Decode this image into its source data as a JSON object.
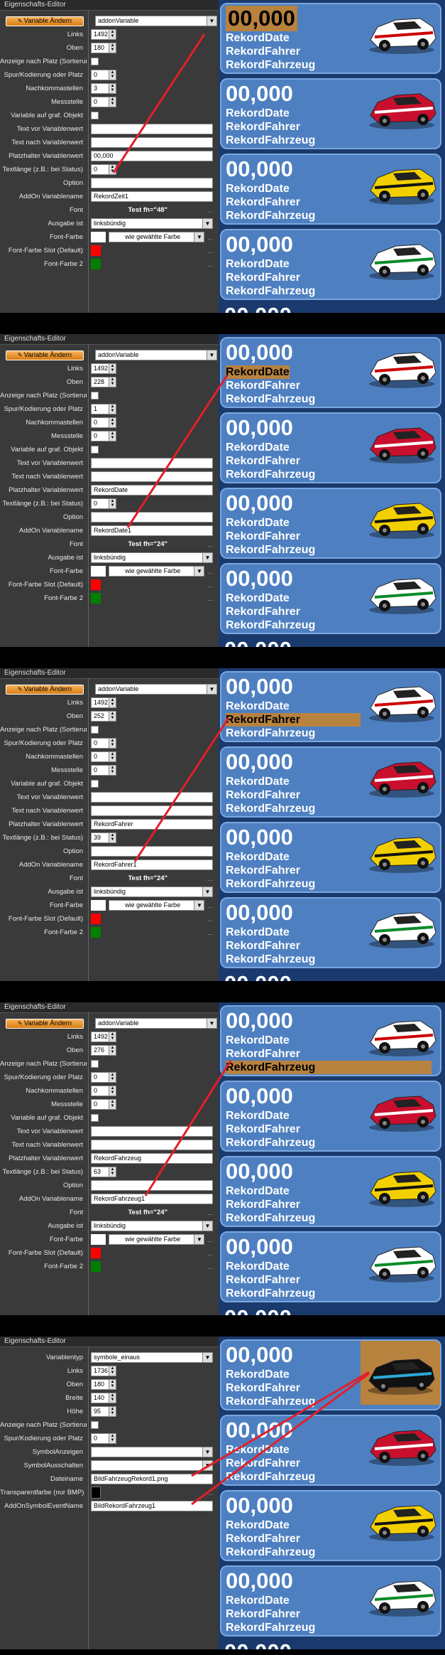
{
  "panels": [
    {
      "title": "Eigenschafts-Editor",
      "button_label": "Variable Ändern",
      "rows": [
        {
          "label": "",
          "type": "sel",
          "value": "addonVariable"
        },
        {
          "label": "Links",
          "type": "num",
          "value": "1492"
        },
        {
          "label": "Oben",
          "type": "num",
          "value": "180"
        },
        {
          "label": "Anzeige nach Platz (Sortierung)",
          "type": "chk"
        },
        {
          "label": "Spur/Kodierung oder Platz",
          "type": "num",
          "value": "0"
        },
        {
          "label": "Nachkommastellen",
          "type": "num",
          "value": "3"
        },
        {
          "label": "Messstelle",
          "type": "num",
          "value": "0"
        },
        {
          "label": "Variable auf graf. Objekt",
          "type": "chk"
        },
        {
          "label": "Text vor Variablenwert",
          "type": "txt",
          "value": ""
        },
        {
          "label": "Text nach Variablenwert",
          "type": "txt",
          "value": ""
        },
        {
          "label": "Platzhalter Variablenwert",
          "type": "txt",
          "value": "00,000"
        },
        {
          "label": "Textlänge (z.B.: bei Status)",
          "type": "num",
          "value": "0"
        },
        {
          "label": "Option",
          "type": "txt",
          "value": ""
        },
        {
          "label": "AddOn Variablename",
          "type": "txt",
          "value": "RekordZeit1"
        },
        {
          "label": "Font",
          "type": "font",
          "value": "Test fh=\"48\""
        },
        {
          "label": "Ausgabe ist",
          "type": "sel",
          "value": "linksbündig"
        },
        {
          "label": "Font-Farbe",
          "type": "color",
          "value": "wie gewählte Farbe",
          "color": "#ffffff"
        },
        {
          "label": "Font-Farbe Slot (Default)",
          "type": "swatch",
          "color": "#ff0000"
        },
        {
          "label": "Font-Farbe 2",
          "type": "swatch",
          "color": "#008000"
        }
      ],
      "highlight": 0,
      "line": [
        160,
        243,
        288,
        48
      ]
    },
    {
      "title": "Eigenschafts-Editor",
      "button_label": "Variable Ändern",
      "rows": [
        {
          "label": "",
          "type": "sel",
          "value": "addonVariable"
        },
        {
          "label": "Links",
          "type": "num",
          "value": "1492"
        },
        {
          "label": "Oben",
          "type": "num",
          "value": "228"
        },
        {
          "label": "Anzeige nach Platz (Sortierung)",
          "type": "chk"
        },
        {
          "label": "Spur/Kodierung oder Platz",
          "type": "num",
          "value": "1"
        },
        {
          "label": "Nachkommastellen",
          "type": "num",
          "value": "0"
        },
        {
          "label": "Messstelle",
          "type": "num",
          "value": "0"
        },
        {
          "label": "Variable auf graf. Objekt",
          "type": "chk"
        },
        {
          "label": "Text vor Variablenwert",
          "type": "txt",
          "value": ""
        },
        {
          "label": "Text nach Variablenwert",
          "type": "txt",
          "value": ""
        },
        {
          "label": "Platzhalter Variablenwert",
          "type": "txt",
          "value": "RekordDate"
        },
        {
          "label": "Textlänge (z.B.: bei Status)",
          "type": "num",
          "value": "0"
        },
        {
          "label": "Option",
          "type": "txt",
          "value": ""
        },
        {
          "label": "AddOn Variablename",
          "type": "txt",
          "value": "RekordDate1"
        },
        {
          "label": "Font",
          "type": "font",
          "value": "Test fh=\"24\""
        },
        {
          "label": "Ausgabe ist",
          "type": "sel",
          "value": "linksbündig"
        },
        {
          "label": "Font-Farbe",
          "type": "color",
          "value": "wie gewählte Farbe",
          "color": "#ffffff"
        },
        {
          "label": "Font-Farbe Slot (Default)",
          "type": "swatch",
          "color": "#ff0000"
        },
        {
          "label": "Font-Farbe 2",
          "type": "swatch",
          "color": "#008000"
        }
      ],
      "highlight": 1,
      "line": [
        180,
        272,
        320,
        58
      ]
    },
    {
      "title": "Eigenschafts-Editor",
      "button_label": "Variable Ändern",
      "rows": [
        {
          "label": "",
          "type": "sel",
          "value": "addonVariable"
        },
        {
          "label": "Links",
          "type": "num",
          "value": "1492"
        },
        {
          "label": "Oben",
          "type": "num",
          "value": "252"
        },
        {
          "label": "Anzeige nach Platz (Sortierung)",
          "type": "chk"
        },
        {
          "label": "Spur/Kodierung oder Platz",
          "type": "num",
          "value": "0"
        },
        {
          "label": "Nachkommastellen",
          "type": "num",
          "value": "0"
        },
        {
          "label": "Messstelle",
          "type": "num",
          "value": "0"
        },
        {
          "label": "Variable auf graf. Objekt",
          "type": "chk"
        },
        {
          "label": "Text vor Variablenwert",
          "type": "txt",
          "value": ""
        },
        {
          "label": "Text nach Variablenwert",
          "type": "txt",
          "value": ""
        },
        {
          "label": "Platzhalter Variablenwert",
          "type": "txt",
          "value": "RekordFahrer"
        },
        {
          "label": "Textlänge (z.B.: bei Status)",
          "type": "num",
          "value": "39"
        },
        {
          "label": "Option",
          "type": "txt",
          "value": ""
        },
        {
          "label": "AddOn Variablename",
          "type": "txt",
          "value": "RekordFahrer1"
        },
        {
          "label": "Font",
          "type": "font",
          "value": "Test fh=\"24\""
        },
        {
          "label": "Ausgabe ist",
          "type": "sel",
          "value": "linksbündig"
        },
        {
          "label": "Font-Farbe",
          "type": "color",
          "value": "wie gewählte Farbe",
          "color": "#ffffff"
        },
        {
          "label": "Font-Farbe Slot (Default)",
          "type": "swatch",
          "color": "#ff0000"
        },
        {
          "label": "Font-Farbe 2",
          "type": "swatch",
          "color": "#008000"
        }
      ],
      "highlight": 2,
      "line": [
        190,
        272,
        322,
        70
      ]
    },
    {
      "title": "Eigenschafts-Editor",
      "button_label": "Variable Ändern",
      "rows": [
        {
          "label": "",
          "type": "sel",
          "value": "addonVariable"
        },
        {
          "label": "Links",
          "type": "num",
          "value": "1492"
        },
        {
          "label": "Oben",
          "type": "num",
          "value": "276"
        },
        {
          "label": "Anzeige nach Platz (Sortierung)",
          "type": "chk"
        },
        {
          "label": "Spur/Kodierung oder Platz",
          "type": "num",
          "value": "0"
        },
        {
          "label": "Nachkommastellen",
          "type": "num",
          "value": "0"
        },
        {
          "label": "Messstelle",
          "type": "num",
          "value": "0"
        },
        {
          "label": "Variable auf graf. Objekt",
          "type": "chk"
        },
        {
          "label": "Text vor Variablenwert",
          "type": "txt",
          "value": ""
        },
        {
          "label": "Text nach Variablenwert",
          "type": "txt",
          "value": ""
        },
        {
          "label": "Platzhalter Variablenwert",
          "type": "txt",
          "value": "RekordFahrzeug"
        },
        {
          "label": "Textlänge (z.B.: bei Status)",
          "type": "num",
          "value": "63"
        },
        {
          "label": "Option",
          "type": "txt",
          "value": ""
        },
        {
          "label": "AddOn Variablename",
          "type": "txt",
          "value": "RekordFahrzeug1"
        },
        {
          "label": "Font",
          "type": "font",
          "value": "Test fh=\"24\""
        },
        {
          "label": "Ausgabe ist",
          "type": "sel",
          "value": "linksbündig"
        },
        {
          "label": "Font-Farbe",
          "type": "color",
          "value": "wie gewählte Farbe",
          "color": "#ffffff"
        },
        {
          "label": "Font-Farbe Slot (Default)",
          "type": "swatch",
          "color": "#ff0000"
        },
        {
          "label": "Font-Farbe 2",
          "type": "swatch",
          "color": "#008000"
        }
      ],
      "highlight": 3,
      "line": [
        205,
        272,
        325,
        82
      ]
    },
    {
      "title": "Eigenschafts-Editor",
      "button_label": "",
      "rows": [
        {
          "label": "Variablentyp",
          "type": "sel",
          "value": "symbole_einaus"
        },
        {
          "label": "Links",
          "type": "num",
          "value": "1736"
        },
        {
          "label": "Oben",
          "type": "num",
          "value": "180"
        },
        {
          "label": "Breite",
          "type": "num",
          "value": "140"
        },
        {
          "label": "Höhe",
          "type": "num",
          "value": "95"
        },
        {
          "label": "Anzeige nach Platz (Sortierung)",
          "type": "chk"
        },
        {
          "label": "Spur/Kodierung oder Platz",
          "type": "num",
          "value": "0"
        },
        {
          "label": "SymbolAnzeigen",
          "type": "sel",
          "value": ""
        },
        {
          "label": "SymbolAusschalten",
          "type": "sel",
          "value": ""
        },
        {
          "label": "Dateiname",
          "type": "txt",
          "value": "BildFahrzeugRekord1.png"
        },
        {
          "label": "Transparentfarbe (nur BMP)",
          "type": "swatch",
          "color": "#000000"
        },
        {
          "label": "AddOnSymbolEventName",
          "type": "txt",
          "value": "BildRekordFahrzeug1"
        }
      ],
      "highlight": 4,
      "line": [
        270,
        196,
        520,
        50
      ]
    }
  ],
  "preview": {
    "cards": [
      {
        "line1": "00,000",
        "line2": "RekordDate",
        "line3": "RekordFahrer",
        "line4": "RekordFahrzeug",
        "car_color": "#ffffff",
        "car_accent": "#cc0000"
      },
      {
        "line1": "00,000",
        "line2": "RekordDate",
        "line3": "RekordFahrer",
        "line4": "RekordFahrzeug",
        "car_color": "#c8102e",
        "car_accent": "#ffffff"
      },
      {
        "line1": "00,000",
        "line2": "RekordDate",
        "line3": "RekordFahrer",
        "line4": "RekordFahrzeug",
        "car_color": "#f2d000",
        "car_accent": "#111111"
      },
      {
        "line1": "00,000",
        "line2": "RekordDate",
        "line3": "RekordFahrer",
        "line4": "RekordFahrzeug",
        "car_color": "#ffffff",
        "car_accent": "#0a8a2a"
      }
    ],
    "partial_line": "00,000"
  },
  "colors": {
    "card_bg": "#4e80c1",
    "highlight": "#b8823f",
    "arrow": "#e0202a"
  }
}
